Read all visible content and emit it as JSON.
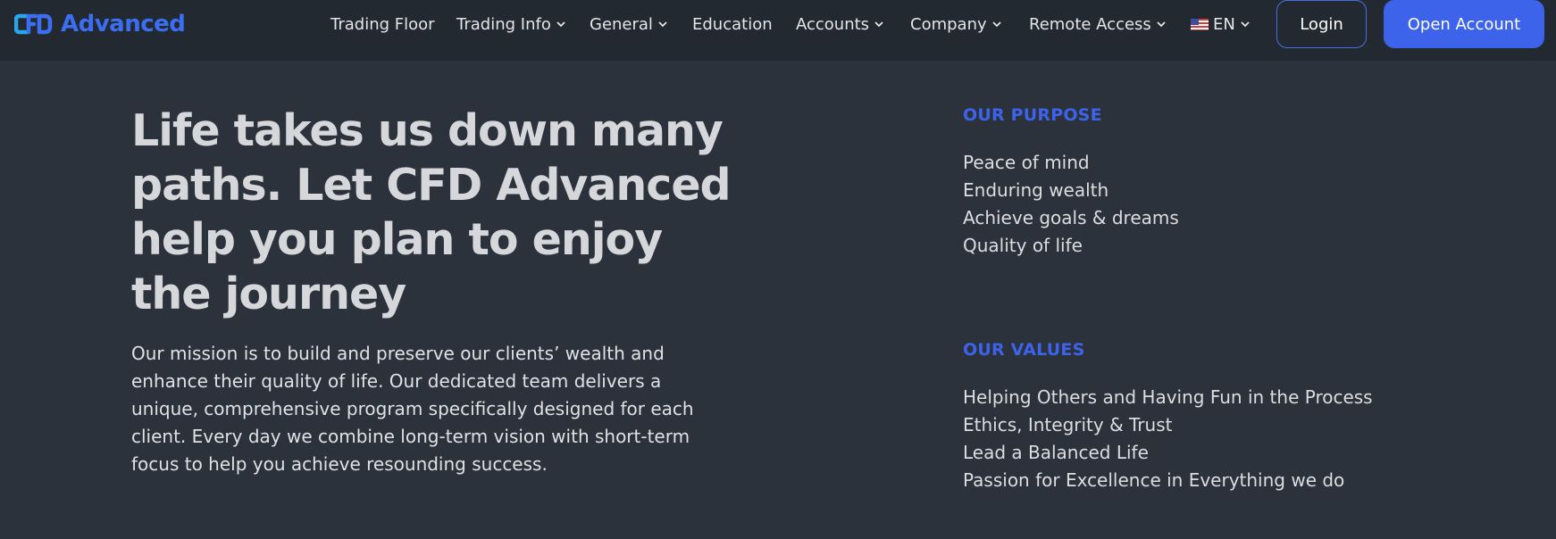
{
  "brand": {
    "name": "Advanced",
    "logo_icon": "cfd-logo-icon",
    "color": "#3b6ef0"
  },
  "nav": {
    "items": [
      {
        "label": "Trading Floor",
        "has_dropdown": false
      },
      {
        "label": "Trading Info",
        "has_dropdown": true
      },
      {
        "label": "General",
        "has_dropdown": true
      },
      {
        "label": "Education",
        "has_dropdown": false
      },
      {
        "label": "Accounts",
        "has_dropdown": true
      },
      {
        "label": "Company",
        "has_dropdown": true
      },
      {
        "label": "Remote Access",
        "has_dropdown": true
      }
    ],
    "language": {
      "label": "EN",
      "icon": "us-flag-icon"
    },
    "login_label": "Login",
    "open_account_label": "Open Account"
  },
  "hero": {
    "title": "Life takes us down many paths. Let CFD Advanced help you plan to enjoy the journey",
    "mission": "Our mission is to build and preserve our clients’ wealth and enhance their quality of life. Our dedicated team delivers a unique, comprehensive program specifically designed for each client. Every day we combine long-term vision with short-term focus to help you achieve resounding success."
  },
  "purpose": {
    "heading": "OUR PURPOSE",
    "items": [
      "Peace of mind",
      "Enduring wealth",
      "Achieve goals & dreams",
      "Quality of life"
    ]
  },
  "values": {
    "heading": "OUR VALUES",
    "items": [
      "Helping Others and Having Fun in the Process",
      "Ethics, Integrity & Trust",
      "Lead a Balanced Life",
      "Passion for Excellence in Everything we do"
    ]
  },
  "colors": {
    "background": "#2c323b",
    "navbar": "#232930",
    "accent": "#3d63ea"
  }
}
